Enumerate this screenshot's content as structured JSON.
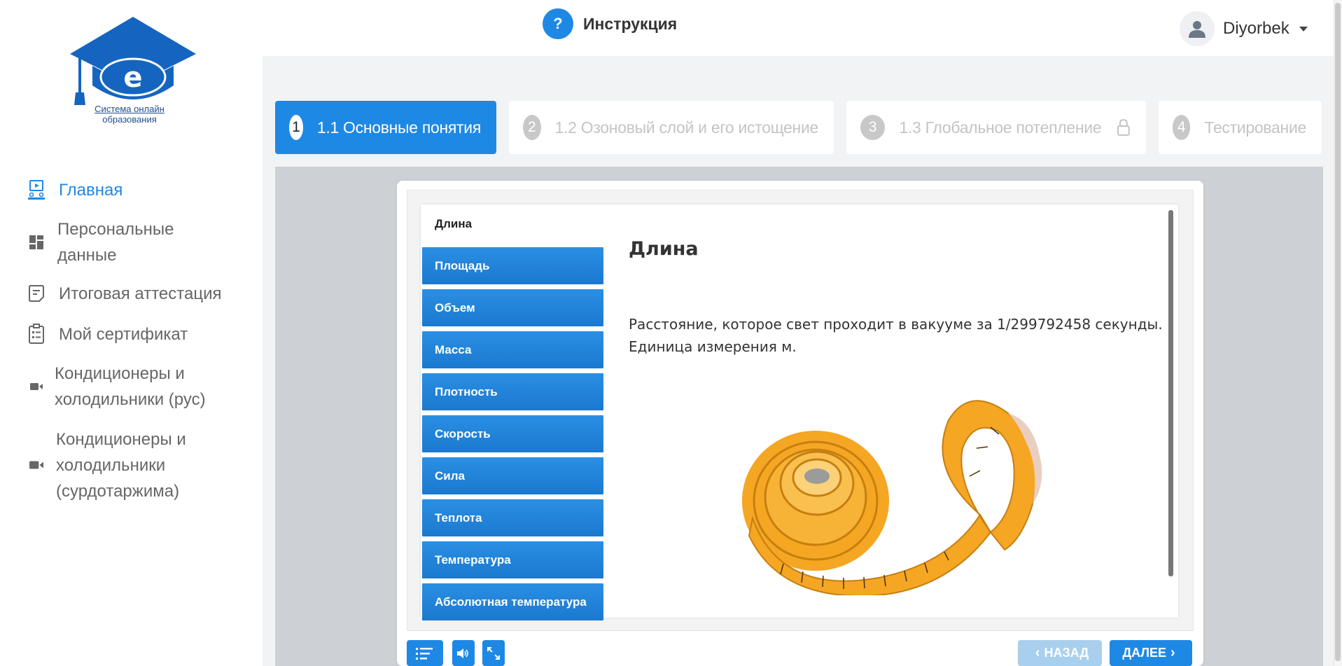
{
  "logo": {
    "letter": "e",
    "caption_line1": "Система онлайн",
    "caption_line2": "образования"
  },
  "sidebar": {
    "items": [
      {
        "label": "Главная",
        "icon": "video-lesson-icon",
        "active": true
      },
      {
        "label": "Персональные\nданные",
        "icon": "dashboard-icon"
      },
      {
        "label": "Итоговая аттестация",
        "icon": "note-icon"
      },
      {
        "label": "Мой сертификат",
        "icon": "clipboard-icon"
      },
      {
        "label": "Кондиционеры и\nхолодильники (рус)",
        "icon": "video-camera-icon"
      },
      {
        "label": "Кондиционеры и\nхолодильники\n(сурдотаржима)",
        "icon": "video-camera-icon"
      }
    ]
  },
  "header": {
    "help_symbol": "?",
    "help_label": "Инструкция",
    "user_name": "Diyorbek"
  },
  "steps": [
    {
      "num": "1",
      "label": "1.1 Основные понятия",
      "active": true
    },
    {
      "num": "2",
      "label": "1.2 Озоновый слой и его истощение"
    },
    {
      "num": "3",
      "label": "1.3 Глобальное потепление",
      "locked": true
    },
    {
      "num": "4",
      "label": "Тестирование"
    }
  ],
  "lesson": {
    "tabs": [
      "Длина",
      "Площадь",
      "Объем",
      "Масса",
      "Плотность",
      "Скорость",
      "Сила",
      "Теплота",
      "Температура",
      "Абсолютная температура"
    ],
    "active_tab": 0,
    "title": "Длина",
    "text": "Расстояние, которое свет проходит в вакууме за 1/299792458 секунды. Единица измерения м.",
    "image": "measuring-tape"
  },
  "controls": {
    "back_label": "НАЗАД",
    "next_label": "ДАЛЕЕ"
  },
  "colors": {
    "accent": "#1e88e5",
    "back_disabled": "#a9cfee"
  }
}
